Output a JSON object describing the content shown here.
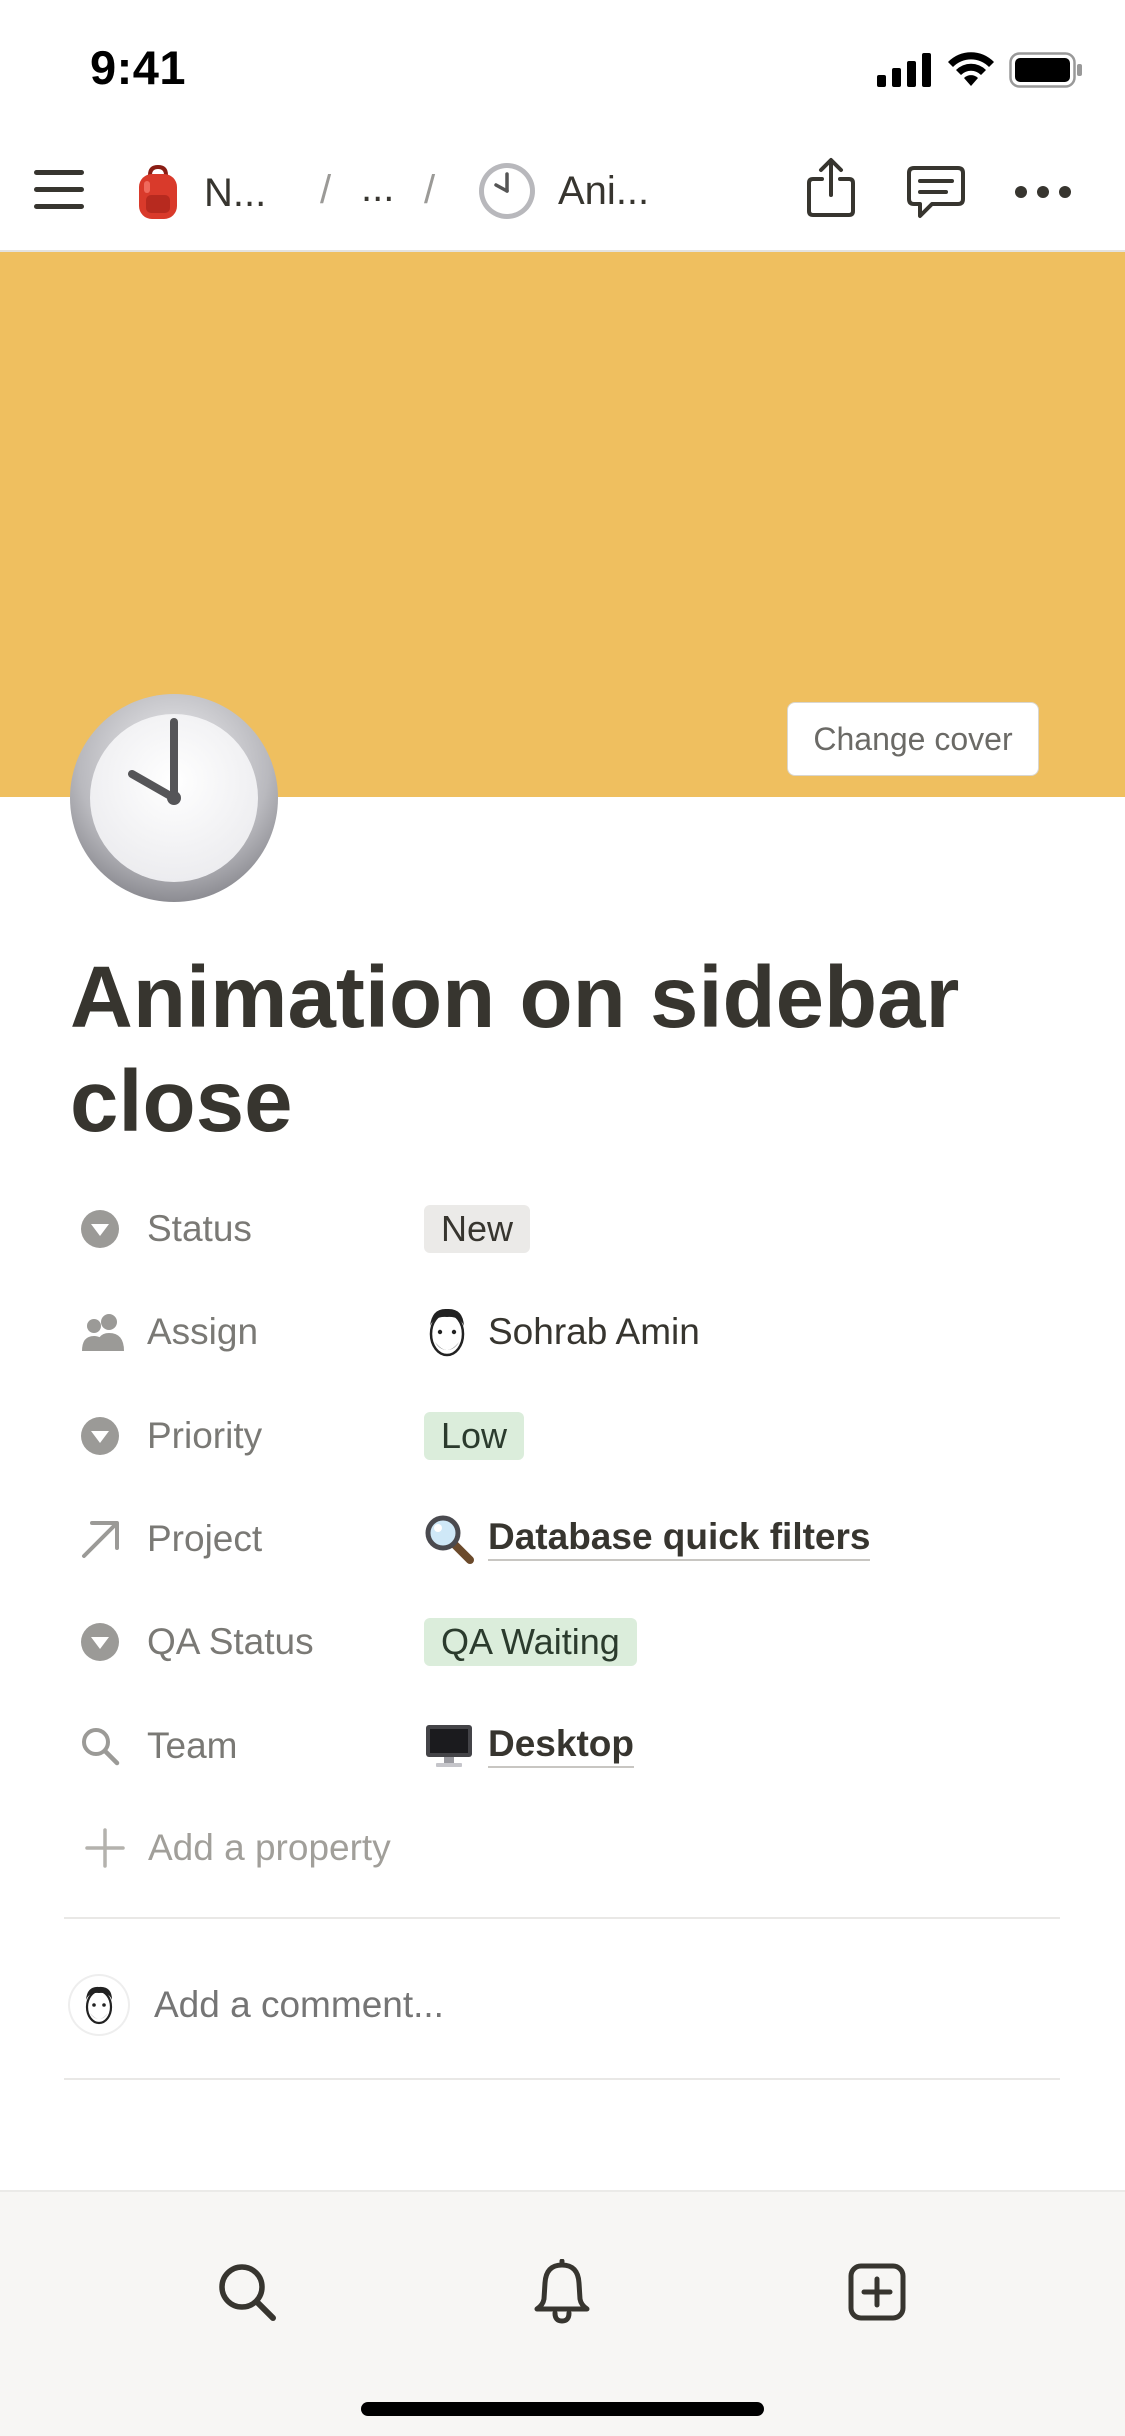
{
  "status_bar": {
    "time": "9:41"
  },
  "topnav": {
    "crumbs": [
      {
        "label": "N...",
        "icon": "backpack-icon"
      },
      {
        "label": "..."
      },
      {
        "label": "Ani...",
        "icon": "clock-icon"
      }
    ],
    "separator": "/"
  },
  "cover": {
    "color": "#efbf5f",
    "change_label": "Change cover"
  },
  "page": {
    "icon": "clock-icon",
    "title": "Animation on sidebar close"
  },
  "properties": [
    {
      "label": "Status",
      "icon": "select-icon",
      "value": "New",
      "kind": "tag-gray"
    },
    {
      "label": "Assign",
      "icon": "person-icon",
      "value": "Sohrab Amin",
      "kind": "person"
    },
    {
      "label": "Priority",
      "icon": "select-icon",
      "value": "Low",
      "kind": "tag-green"
    },
    {
      "label": "Project",
      "icon": "relation-arrow-icon",
      "value": "Database quick filters",
      "kind": "link",
      "value_icon": "magnifier-icon"
    },
    {
      "label": "QA Status",
      "icon": "select-icon",
      "value": "QA Waiting",
      "kind": "tag-green"
    },
    {
      "label": "Team",
      "icon": "search-icon",
      "value": "Desktop",
      "kind": "link",
      "value_icon": "desktop-computer-icon"
    }
  ],
  "add_property": {
    "label": "Add a property"
  },
  "comment": {
    "placeholder": "Add a comment..."
  },
  "bottom_tabs": [
    {
      "name": "search",
      "icon": "search-icon"
    },
    {
      "name": "notifications",
      "icon": "bell-icon"
    },
    {
      "name": "new-page",
      "icon": "plus-square-icon"
    }
  ]
}
